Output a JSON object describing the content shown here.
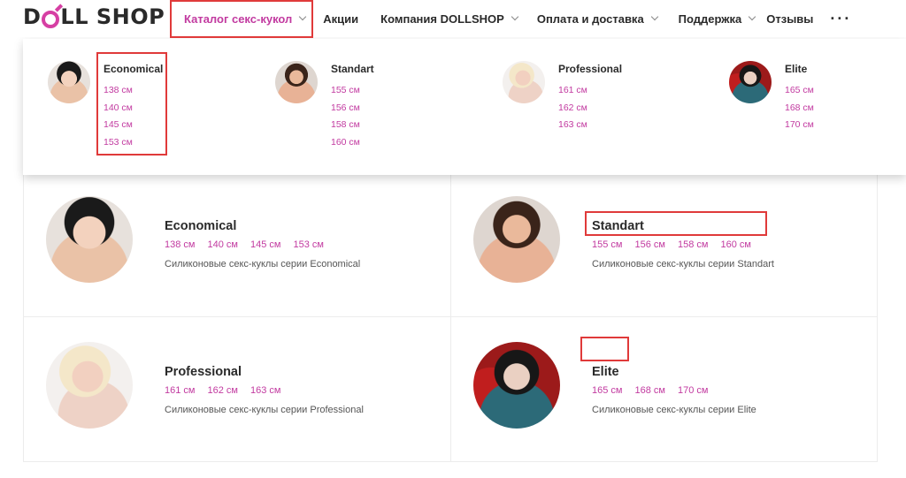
{
  "logo": {
    "part1": "D",
    "part2": "LL SHOP"
  },
  "nav": {
    "catalog": "Каталог секс-кукол",
    "promo": "Акции",
    "company": "Компания DOLLSHOP",
    "delivery": "Оплата и доставка",
    "support": "Поддержка",
    "reviews": "Отзывы",
    "more": "···"
  },
  "dropdown": [
    {
      "title": "Economical",
      "sizes": [
        "138 см",
        "140 см",
        "145 см",
        "153 см"
      ]
    },
    {
      "title": "Standart",
      "sizes": [
        "155 см",
        "156 см",
        "158 см",
        "160 см"
      ]
    },
    {
      "title": "Professional",
      "sizes": [
        "161 см",
        "162 см",
        "163 см"
      ]
    },
    {
      "title": "Elite",
      "sizes": [
        "165 см",
        "168 см",
        "170 см"
      ]
    }
  ],
  "categories": [
    {
      "title": "Economical",
      "sizes": [
        "138 см",
        "140 см",
        "145 см",
        "153 см"
      ],
      "desc": "Силиконовые секс-куклы серии Economical"
    },
    {
      "title": "Standart",
      "sizes": [
        "155 см",
        "156 см",
        "158 см",
        "160 см"
      ],
      "desc": "Силиконовые секс-куклы серии Standart"
    },
    {
      "title": "Professional",
      "sizes": [
        "161 см",
        "162 см",
        "163 см"
      ],
      "desc": "Силиконовые секс-куклы серии Professional"
    },
    {
      "title": "Elite",
      "sizes": [
        "165 см",
        "168 см",
        "170 см"
      ],
      "desc": "Силиконовые секс-куклы серии Elite"
    }
  ],
  "colors": {
    "accent": "#c23aa0",
    "highlight": "#e03a3a"
  }
}
